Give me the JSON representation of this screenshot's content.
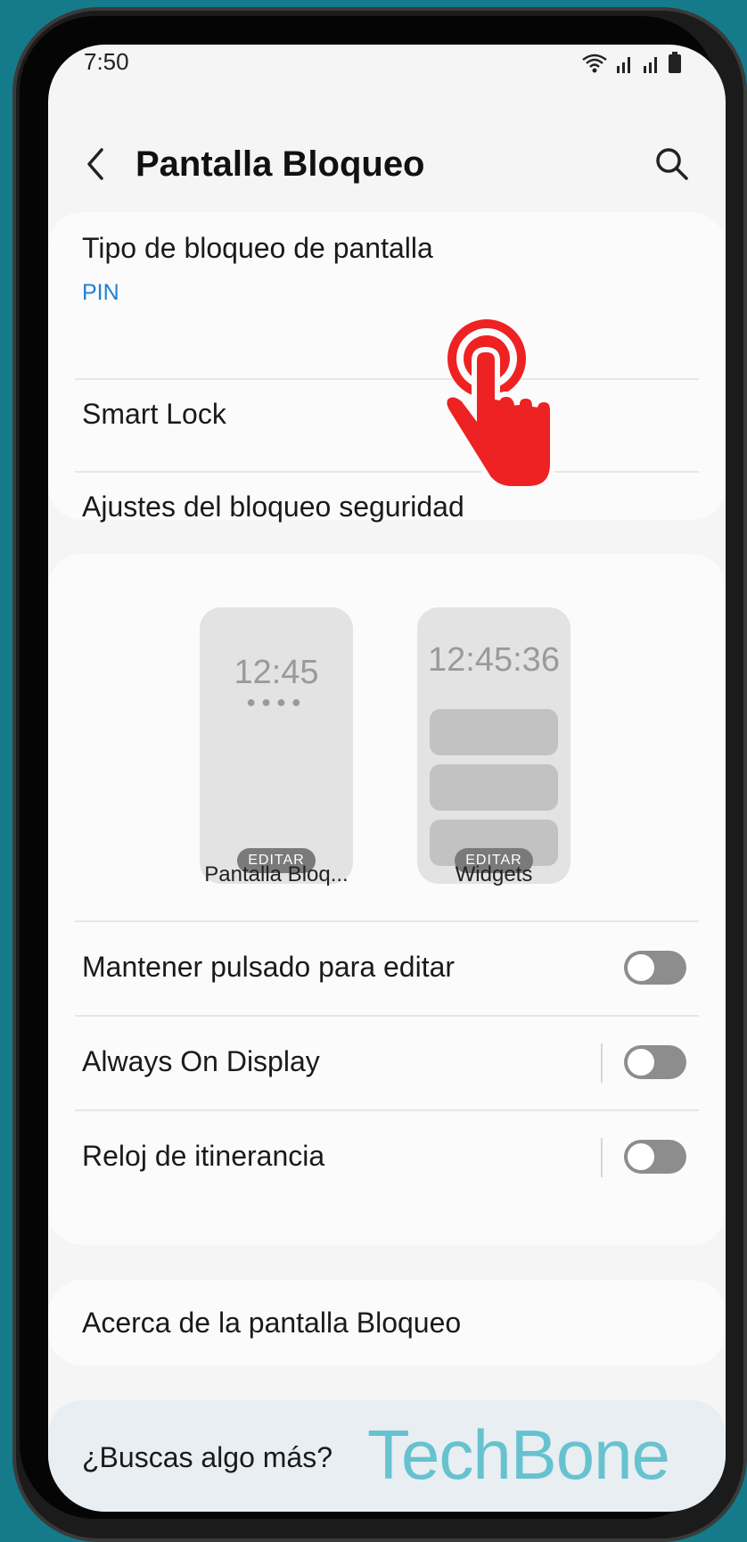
{
  "status": {
    "time": "7:50"
  },
  "header": {
    "title": "Pantalla Bloqueo"
  },
  "lock_section": {
    "type_title": "Tipo de bloqueo de pantalla",
    "type_value": "PIN",
    "smart_lock": "Smart Lock",
    "security_settings": "Ajustes del bloqueo seguridad"
  },
  "previews": {
    "lock_screen": {
      "time": "12:45",
      "edit_label": "EDITAR",
      "label": "Pantalla Bloq..."
    },
    "widgets": {
      "time": "12:45:36",
      "edit_label": "EDITAR",
      "label": "Widgets"
    }
  },
  "settings": {
    "hold_to_edit": {
      "label": "Mantener pulsado para editar",
      "enabled": false
    },
    "always_on_display": {
      "label": "Always On Display",
      "enabled": false
    },
    "roaming_clock": {
      "label": "Reloj de itinerancia",
      "enabled": false
    }
  },
  "about": {
    "label": "Acerca de la pantalla Bloqueo"
  },
  "more": {
    "label": "¿Buscas algo más?"
  },
  "watermark": "TechBone",
  "colors": {
    "accent": "#1f7fd6",
    "touch_indicator": "#ee2222",
    "background": "#157a8a"
  }
}
